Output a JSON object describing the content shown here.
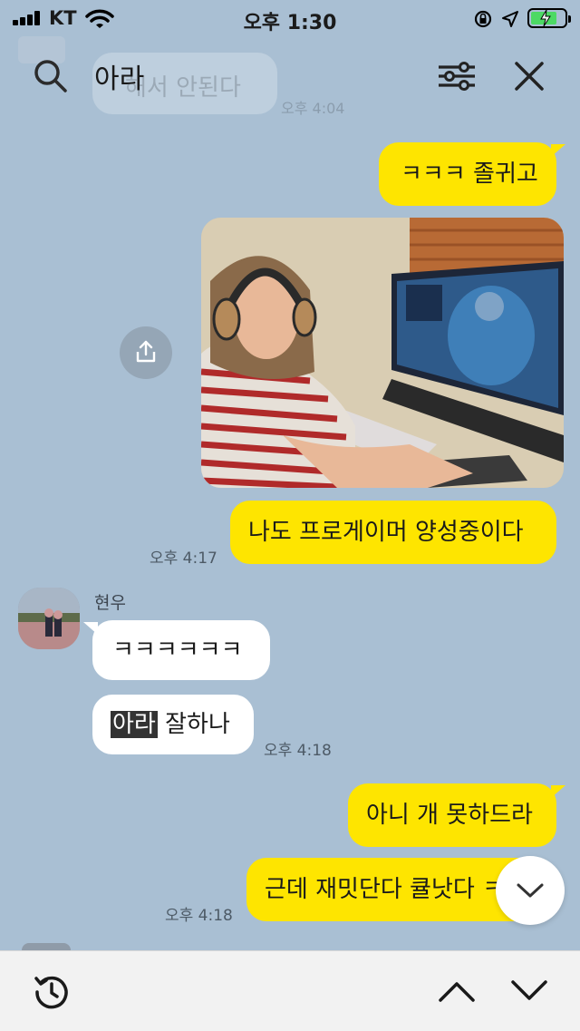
{
  "status_bar": {
    "carrier": "KT",
    "time": "오후 1:30"
  },
  "search": {
    "query": "아라"
  },
  "ghost_message": {
    "text": "해서 안된다",
    "time": "오후 4:04"
  },
  "messages": [
    {
      "side": "me",
      "text": "ㅋㅋㅋ 졸귀고"
    },
    {
      "side": "me",
      "type": "photo"
    },
    {
      "side": "me",
      "text": "나도 프로게이머 양성중이다",
      "time": "오후 4:17"
    },
    {
      "side": "other",
      "sender": "현우",
      "text": "ㅋㅋㅋㅋㅋㅋ"
    },
    {
      "side": "other",
      "highlight": "아라",
      "text": "잘하나",
      "time": "오후 4:18"
    },
    {
      "side": "me",
      "text": "아니 개 못하드라"
    },
    {
      "side": "me",
      "text": "근데 재밋단다 큘낫다 ㅋ",
      "time": "오후 4:18"
    }
  ],
  "colors": {
    "background": "#a9bfd3",
    "my_bubble": "#fee500",
    "their_bubble": "#ffffff"
  }
}
